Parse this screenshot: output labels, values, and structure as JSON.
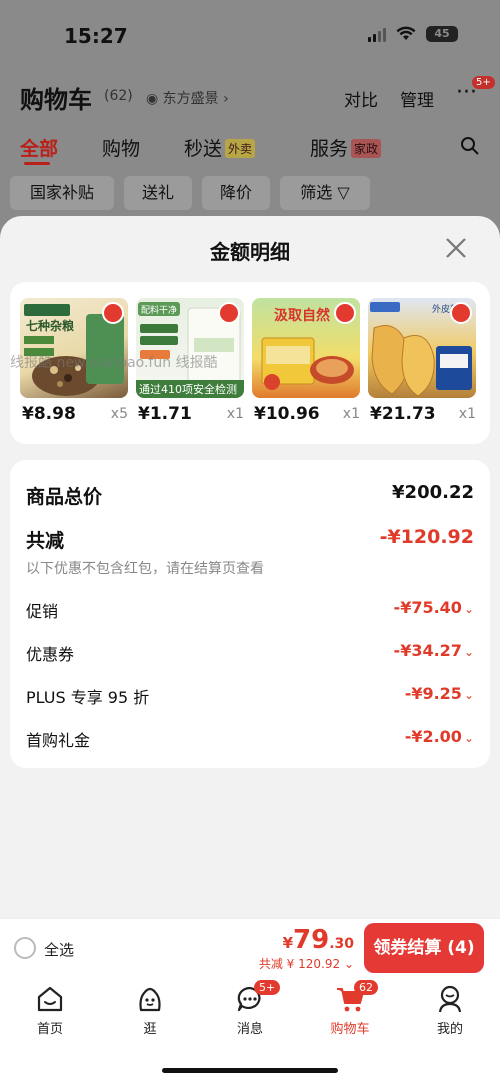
{
  "status": {
    "time": "15:27",
    "battery": "45"
  },
  "header": {
    "title": "购物车",
    "count": "(62)",
    "location": "东方盛景",
    "compare": "对比",
    "manage": "管理",
    "more_badge": "5+"
  },
  "tabs": [
    {
      "label": "全部"
    },
    {
      "label": "购物"
    },
    {
      "label": "秒送",
      "tag": "外卖"
    },
    {
      "label": "服务",
      "tag": "家政"
    }
  ],
  "filters": [
    "国家补贴",
    "送礼",
    "降价",
    "筛选"
  ],
  "sheet": {
    "title": "金额明细"
  },
  "products": [
    {
      "price": "¥8.98",
      "qty": "x5"
    },
    {
      "price": "¥1.71",
      "qty": "x1"
    },
    {
      "price": "¥10.96",
      "qty": "x1"
    },
    {
      "price": "¥21.73",
      "qty": "x1"
    }
  ],
  "product_art": {
    "p1_top": "七种杂粮",
    "p2_top": "配料干净",
    "p2_banner": "通过410项安全检测",
    "p3_top": "汲取自然",
    "p4_top": "外皮薄"
  },
  "watermark": "线报酷 new.xianbao.fun 线报酷",
  "summary": {
    "total_label": "商品总价",
    "total_value": "¥200.22",
    "discount_label": "共减",
    "discount_value": "-¥120.92",
    "note": "以下优惠不包含红包，请在结算页查看",
    "items": [
      {
        "label": "促销",
        "value": "-¥75.40"
      },
      {
        "label": "优惠券",
        "value": "-¥34.27"
      },
      {
        "label": "PLUS 专享 95 折",
        "value": "-¥9.25"
      },
      {
        "label": "首购礼金",
        "value": "-¥2.00"
      }
    ]
  },
  "checkout": {
    "select_all": "全选",
    "currency": "¥",
    "price_int": "79",
    "price_dec": ".30",
    "discount_text": "共减 ¥ 120.92",
    "button": "领券结算 (4)"
  },
  "nav": [
    {
      "label": "首页",
      "icon": "home-icon"
    },
    {
      "label": "逛",
      "icon": "explore-icon"
    },
    {
      "label": "消息",
      "icon": "message-icon",
      "badge": "5+"
    },
    {
      "label": "购物车",
      "icon": "cart-icon",
      "badge": "62"
    },
    {
      "label": "我的",
      "icon": "profile-icon"
    }
  ],
  "colors": {
    "accent": "#e53935",
    "price_red": "#e03b2a",
    "sheet_bg": "#f2f2f2"
  }
}
